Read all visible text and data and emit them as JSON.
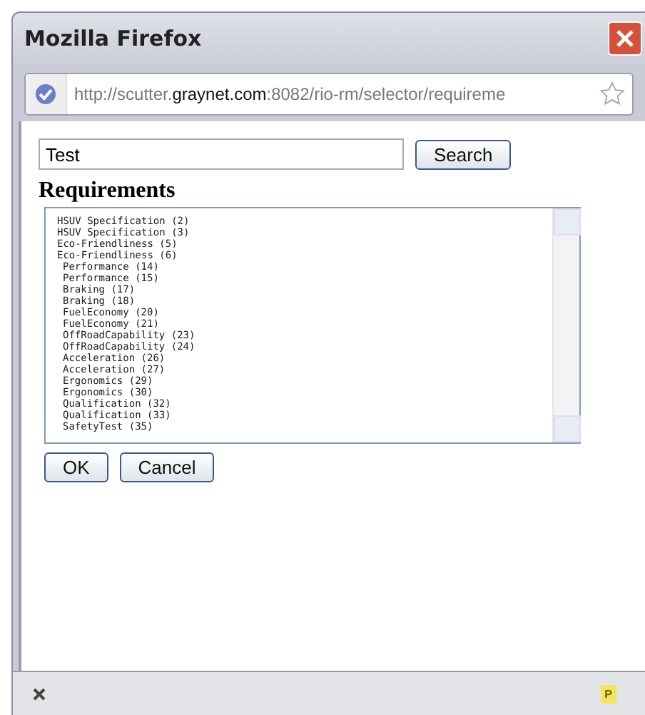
{
  "window": {
    "title": "Mozilla Firefox"
  },
  "address_bar": {
    "url": "http://scutter.**graynet.com**:8082/rio-rm/selector/requireme"
  },
  "search": {
    "value": "Test",
    "button": "Search"
  },
  "heading": "Requirements",
  "list": {
    "items": [
      {
        "label": "HSUV Specification (2)"
      },
      {
        "label": "HSUV Specification (3)"
      },
      {
        "label": "Eco-Friendliness (5)"
      },
      {
        "label": "Eco-Friendliness (6)",
        "children": [
          {
            "label": "Performance (14)"
          },
          {
            "label": "Performance (15)"
          },
          {
            "label": "Braking (17)"
          },
          {
            "label": "Braking (18)"
          },
          {
            "label": "FuelEconomy (20)"
          },
          {
            "label": "FuelEconomy (21)"
          },
          {
            "label": "OffRoadCapability (23)"
          },
          {
            "label": "OffRoadCapability (24)"
          },
          {
            "label": "Acceleration (26)"
          },
          {
            "label": "Acceleration (27)"
          },
          {
            "label": "Ergonomics (29)"
          },
          {
            "label": "Ergonomics (30)"
          },
          {
            "label": "Qualification (32)"
          },
          {
            "label": "Qualification (33)"
          },
          {
            "label": "SafetyTest (35)"
          }
        ]
      }
    ]
  },
  "buttons": [
    "OK",
    "Cancel"
  ],
  "status_bar": {
    "badge": "P"
  }
}
